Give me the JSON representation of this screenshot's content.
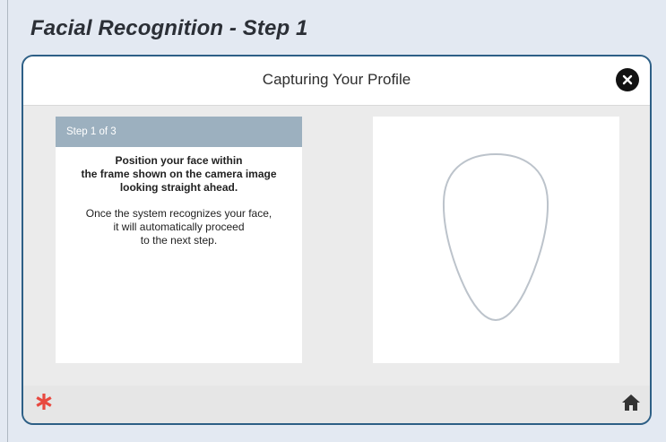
{
  "page": {
    "title": "Facial Recognition - Step 1"
  },
  "dialog": {
    "title": "Capturing Your Profile",
    "close_icon": "close-icon",
    "step_label": "Step 1 of 3",
    "instruction_main": "Position your face within\nthe frame shown on the camera image\nlooking straight ahead.",
    "instruction_sub": "Once the system recognizes your face,\nit will automatically proceed\nto the next step.",
    "camera_frame_icon": "face-outline-guide"
  },
  "footer": {
    "left_icon": "asterisk-icon",
    "right_icon": "home-icon"
  },
  "colors": {
    "page_bg": "#e3e9f2",
    "dialog_border": "#2d5f86",
    "step_header_bg": "#9cb0bf",
    "asterisk": "#e8483f",
    "face_outline": "#bcc3cb"
  }
}
